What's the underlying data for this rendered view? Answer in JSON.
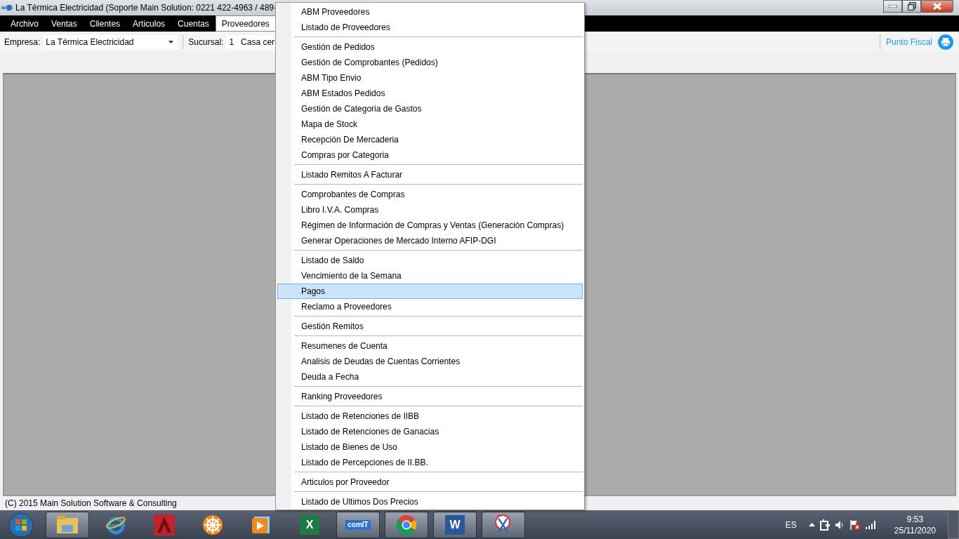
{
  "window": {
    "title": "La Térmica Electricidad (Soporte Main Solution: 0221 422-4963 / 489-"
  },
  "menu_bar": [
    {
      "label": "Archivo",
      "selected": false
    },
    {
      "label": "Ventas",
      "selected": false
    },
    {
      "label": "Clientes",
      "selected": false
    },
    {
      "label": "Articulos",
      "selected": false
    },
    {
      "label": "Cuentas",
      "selected": false
    },
    {
      "label": "Proveedores",
      "selected": true
    }
  ],
  "toolbar": {
    "empresa_label": "Empresa:",
    "empresa_value": "La Térmica Electricidad",
    "sucursal_label": "Sucursal:",
    "sucursal_number": "1",
    "sucursal_name": "Casa cer",
    "punto_fiscal": "Punto Fiscal"
  },
  "dropdown_menu": {
    "groups": [
      [
        {
          "label": "ABM Proveedores",
          "selected": false
        },
        {
          "label": "Listado de Proveedores",
          "selected": false
        }
      ],
      [
        {
          "label": "Gestión de Pedidos",
          "selected": false
        },
        {
          "label": "Gestión de Comprobantes (Pedidos)",
          "selected": false
        },
        {
          "label": "ABM Tipo Envio",
          "selected": false
        },
        {
          "label": "ABM Estados Pedidos",
          "selected": false
        },
        {
          "label": "Gestión de Categoria de Gastos",
          "selected": false
        },
        {
          "label": "Mapa de Stock",
          "selected": false
        },
        {
          "label": "Recepción De Mercaderia",
          "selected": false
        },
        {
          "label": "Compras por Categoria",
          "selected": false
        }
      ],
      [
        {
          "label": "Listado Remitos A Facturar",
          "selected": false
        }
      ],
      [
        {
          "label": "Comprobantes de Compras",
          "selected": false
        },
        {
          "label": "Libro I.V.A. Compras",
          "selected": false
        },
        {
          "label": "Régimen de Información de Compras y Ventas (Generación Compras)",
          "selected": false
        },
        {
          "label": "Generar Operaciones de Mercado Interno AFIP-DGI",
          "selected": false
        }
      ],
      [
        {
          "label": "Listado de Saldo",
          "selected": false
        },
        {
          "label": "Vencimiento de la Semana",
          "selected": false
        },
        {
          "label": "Pagos",
          "selected": true
        },
        {
          "label": "Reclamo a Proveedores",
          "selected": false
        }
      ],
      [
        {
          "label": "Gestión Remitos",
          "selected": false
        }
      ],
      [
        {
          "label": "Resumenes de Cuenta",
          "selected": false
        },
        {
          "label": "Analisis de Deudas de Cuentas Corrientes",
          "selected": false
        },
        {
          "label": "Deuda a Fecha",
          "selected": false
        }
      ],
      [
        {
          "label": "Ranking Proveedores",
          "selected": false
        }
      ],
      [
        {
          "label": "Listado de Retenciones de IIBB",
          "selected": false
        },
        {
          "label": "Listado de Retenciones de Ganacias",
          "selected": false
        },
        {
          "label": "Listado de Bienes de Uso",
          "selected": false
        },
        {
          "label": "Listado de Percepciones de II.BB.",
          "selected": false
        }
      ],
      [
        {
          "label": "Articulos por Proveedor",
          "selected": false
        }
      ],
      [
        {
          "label": "Listado de Ultimos Dos Precios",
          "selected": false
        }
      ]
    ]
  },
  "status_bar": "(C) 2015 Main Solution Software & Consulting",
  "taskbar": {
    "apps": [
      {
        "kind": "folder",
        "open": true
      },
      {
        "kind": "ie",
        "open": false
      },
      {
        "kind": "cad",
        "open": false
      },
      {
        "kind": "wheel",
        "open": false
      },
      {
        "kind": "media",
        "open": false
      },
      {
        "kind": "excel",
        "open": false,
        "glyph": "X"
      },
      {
        "kind": "comit",
        "open": true,
        "glyph": "comIT"
      },
      {
        "kind": "chrome",
        "open": true
      },
      {
        "kind": "word",
        "open": true,
        "glyph": "W"
      },
      {
        "kind": "snip",
        "open": true
      }
    ],
    "language": "ES",
    "time": "9:53",
    "date": "25/11/2020"
  }
}
